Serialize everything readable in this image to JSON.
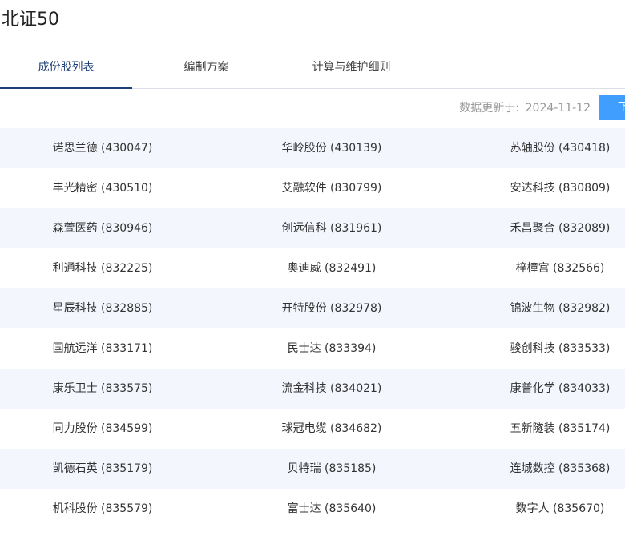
{
  "page": {
    "title": "北证50"
  },
  "tabs": [
    {
      "label": "成份股列表"
    },
    {
      "label": "编制方案"
    },
    {
      "label": "计算与维护细则"
    }
  ],
  "update": {
    "label": "数据更新于:",
    "date": "2024-11-12",
    "download_label": "下"
  },
  "constituents": [
    [
      "诺思兰德 (430047)",
      "华岭股份 (430139)",
      "苏轴股份 (430418)"
    ],
    [
      "丰光精密 (430510)",
      "艾融软件 (830799)",
      "安达科技 (830809)"
    ],
    [
      "森萱医药 (830946)",
      "创远信科 (831961)",
      "禾昌聚合 (832089)"
    ],
    [
      "利通科技 (832225)",
      "奥迪威 (832491)",
      "梓橦宫 (832566)"
    ],
    [
      "星辰科技 (832885)",
      "开特股份 (832978)",
      "锦波生物 (832982)"
    ],
    [
      "国航远洋 (833171)",
      "民士达 (833394)",
      "骏创科技 (833533)"
    ],
    [
      "康乐卫士 (833575)",
      "流金科技 (834021)",
      "康普化学 (834033)"
    ],
    [
      "同力股份 (834599)",
      "球冠电缆 (834682)",
      "五新隧装 (835174)"
    ],
    [
      "凯德石英 (835179)",
      "贝特瑞 (835185)",
      "连城数控 (835368)"
    ],
    [
      "机科股份 (835579)",
      "富士达 (835640)",
      "数字人 (835670)"
    ]
  ],
  "colors": {
    "accent": "#1c3f78",
    "button": "#409eff",
    "stripe": "#f3f7fd"
  }
}
